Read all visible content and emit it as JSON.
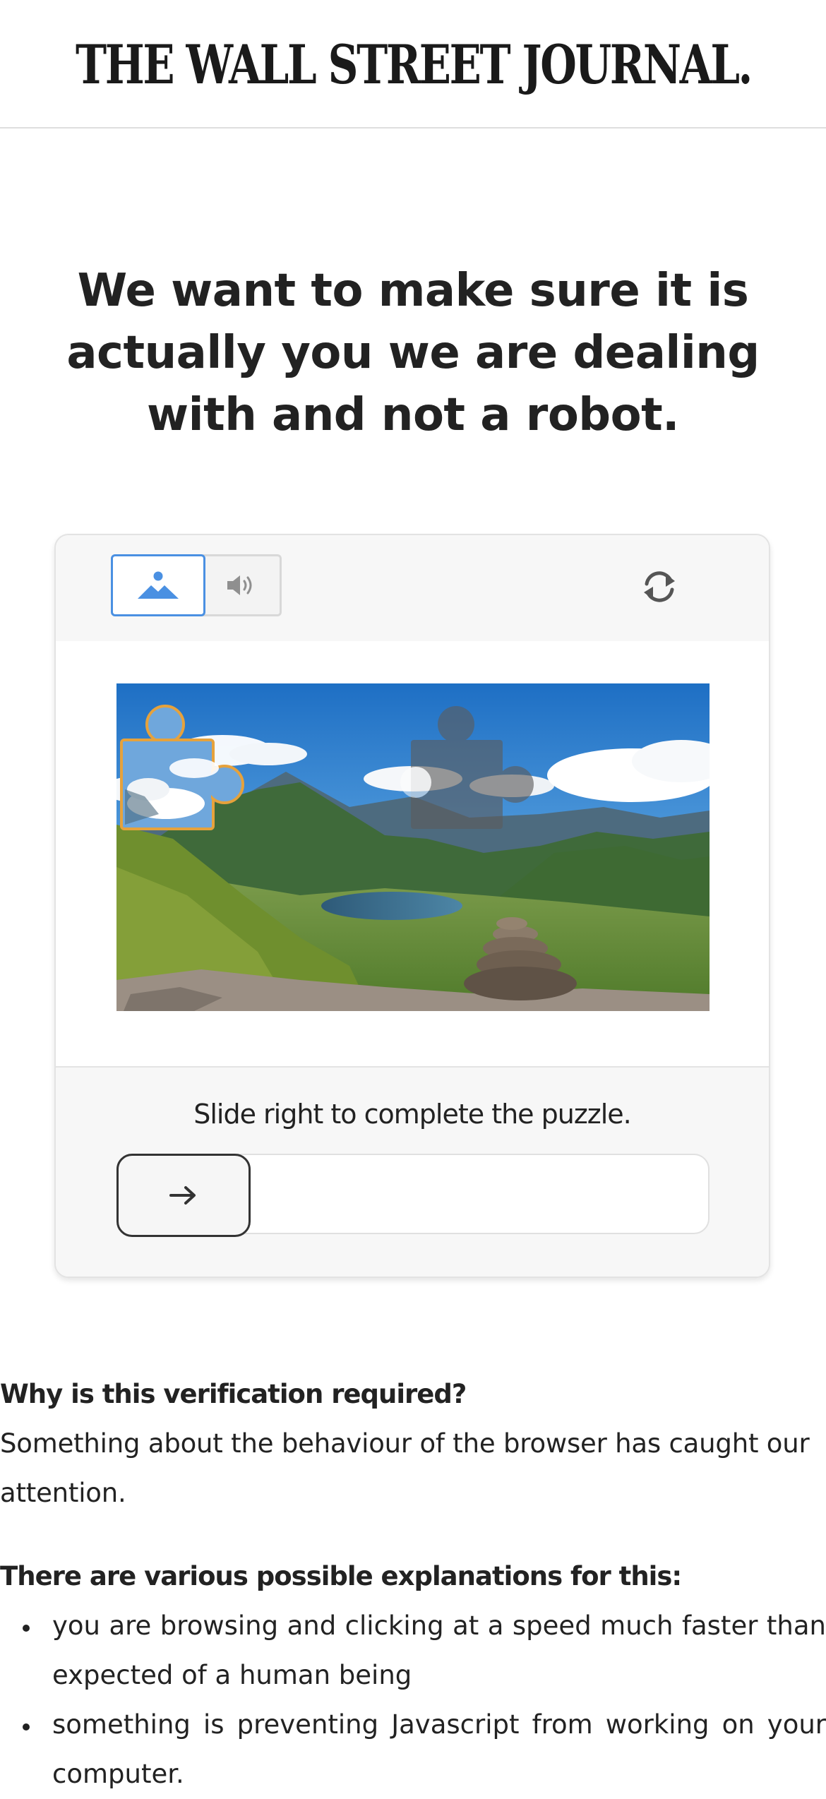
{
  "header": {
    "logo_text": "THE WALL STREET JOURNAL."
  },
  "headline": "We want to make sure it is actually you we are dealing with and not a robot.",
  "captcha": {
    "modes": [
      {
        "icon": "image-mode-icon",
        "selected": true
      },
      {
        "icon": "audio-mode-icon",
        "selected": false
      }
    ],
    "refresh_icon": "refresh-icon",
    "instruction": "Slide right to complete the puzzle.",
    "slider_icon": "arrow-right-icon",
    "slider_progress": 0,
    "colors": {
      "selected_mode_border": "#4a90e2",
      "puzzle_piece_outline": "#e6a23c"
    }
  },
  "info": {
    "why_title": "Why is this verification required?",
    "why_text": "Something about the behaviour of the browser has caught our attention.",
    "explanations_title": "There are various possible explanations for this:",
    "explanations": [
      "you are browsing and clicking at a speed much faster than expected of a human being",
      "something is preventing Javascript from working on your computer."
    ]
  }
}
